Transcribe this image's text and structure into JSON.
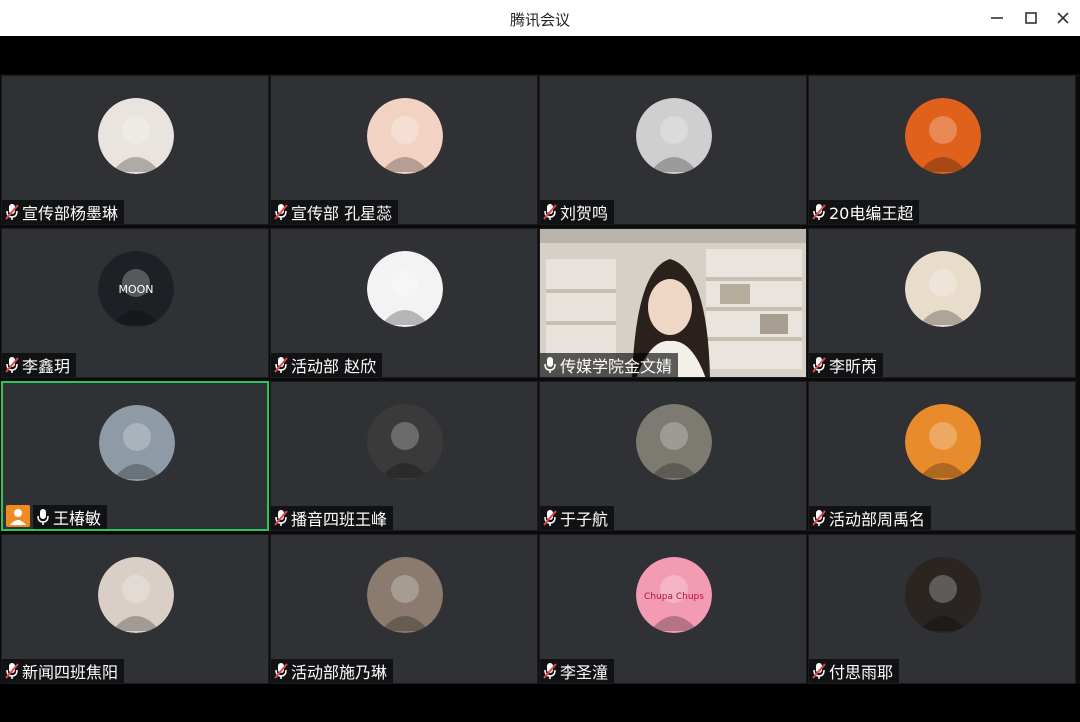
{
  "window": {
    "title": "腾讯会议",
    "controls": [
      "minimize-icon",
      "maximize-icon",
      "close-icon"
    ]
  },
  "participants": [
    {
      "name": "宣传部杨墨琳",
      "mic": "muted",
      "avatar": "red-hair-girl-avatar",
      "avatar_color": "#e9e4df"
    },
    {
      "name": "宣传部 孔星蕊",
      "mic": "muted",
      "avatar": "child-face-avatar",
      "avatar_color": "#f2d3c3"
    },
    {
      "name": "刘贺鸣",
      "mic": "muted",
      "avatar": "cap-boy-avatar",
      "avatar_color": "#cfcfcf"
    },
    {
      "name": "20电编王超",
      "mic": "muted",
      "avatar": "orange-dog-avatar",
      "avatar_color": "#e0611c"
    },
    {
      "name": "李鑫玥",
      "mic": "muted",
      "avatar": "moon-logo-avatar",
      "avatar_color": "#1f2026",
      "avatar_text": "MOON"
    },
    {
      "name": "活动部 赵欣",
      "mic": "muted",
      "avatar": "cartoon-sunglasses-avatar",
      "avatar_color": "#f3f3f3"
    },
    {
      "name": "传媒学院金文婧",
      "mic": "on",
      "avatar": "camera-video-woman",
      "avatar_color": "#c7bfb3",
      "video": true
    },
    {
      "name": "李昕芮",
      "mic": "muted",
      "avatar": "plush-toy-avatar",
      "avatar_color": "#e8dccb"
    },
    {
      "name": "王椿敏",
      "mic": "on",
      "avatar": "clothes-rack-avatar",
      "avatar_color": "#8e9aa6",
      "active": true,
      "host": true
    },
    {
      "name": "播音四班王峰",
      "mic": "muted",
      "avatar": "hiding-face-avatar",
      "avatar_color": "#3a3a3a"
    },
    {
      "name": "于子航",
      "mic": "muted",
      "avatar": "old-man-avatar",
      "avatar_color": "#7d7a72"
    },
    {
      "name": "活动部周禹名",
      "mic": "muted",
      "avatar": "anime-boy-avatar",
      "avatar_color": "#e78b2d"
    },
    {
      "name": "新闻四班焦阳",
      "mic": "muted",
      "avatar": "mask-girl-avatar",
      "avatar_color": "#d9cfc7"
    },
    {
      "name": "活动部施乃琳",
      "mic": "muted",
      "avatar": "group-photo-avatar",
      "avatar_color": "#8a7b6e"
    },
    {
      "name": "李圣潼",
      "mic": "muted",
      "avatar": "pink-lollipop-avatar",
      "avatar_color": "#f29bb3",
      "avatar_text": "Chupa Chups"
    },
    {
      "name": "付思雨耶",
      "mic": "muted",
      "avatar": "dark-portrait-avatar",
      "avatar_color": "#2a2520"
    }
  ],
  "colors": {
    "active_border": "#2fc35a",
    "tile_bg": "#2f3135",
    "host_badge": "#f08a24",
    "mic_muted_red": "#e0474c"
  }
}
